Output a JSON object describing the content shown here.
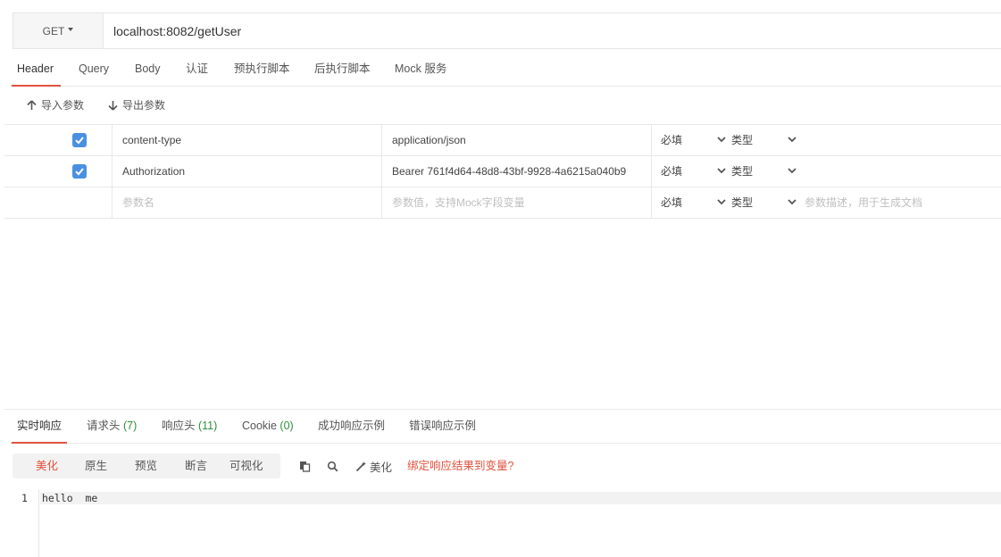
{
  "request": {
    "method": "GET",
    "url": "localhost:8082/getUser"
  },
  "req_tabs": [
    "Header",
    "Query",
    "Body",
    "认证",
    "预执行脚本",
    "后执行脚本",
    "Mock 服务"
  ],
  "toolbar": {
    "import_label": "导入参数",
    "export_label": "导出参数"
  },
  "params": {
    "rows": [
      {
        "checked": true,
        "name": "content-type",
        "value": "application/json",
        "required": "必填",
        "type": "类型"
      },
      {
        "checked": true,
        "name": "Authorization",
        "value": "Bearer 761f4d64-48d8-43bf-9928-4a6215a040b9",
        "required": "必填",
        "type": "类型"
      }
    ],
    "new_row": {
      "name_placeholder": "参数名",
      "value_placeholder": "参数值，支持Mock字段变量",
      "required": "必填",
      "type": "类型",
      "desc_placeholder": "参数描述，用于生成文档"
    }
  },
  "response": {
    "tabs": {
      "live": "实时响应",
      "req_headers": "请求头",
      "req_headers_count": "(7)",
      "resp_headers": "响应头",
      "resp_headers_count": "(11)",
      "cookie": "Cookie",
      "cookie_count": "(0)",
      "success_example": "成功响应示例",
      "error_example": "错误响应示例"
    },
    "view_modes": [
      "美化",
      "原生",
      "预览",
      "断言",
      "可视化"
    ],
    "beautify_label": "美化",
    "bind_label": "绑定响应结果到变量?",
    "line_number": "1",
    "body": "hello  me"
  },
  "colors": {
    "accent": "#e0523f",
    "checkbox": "#4a90e2",
    "count": "#2f8f3b"
  }
}
